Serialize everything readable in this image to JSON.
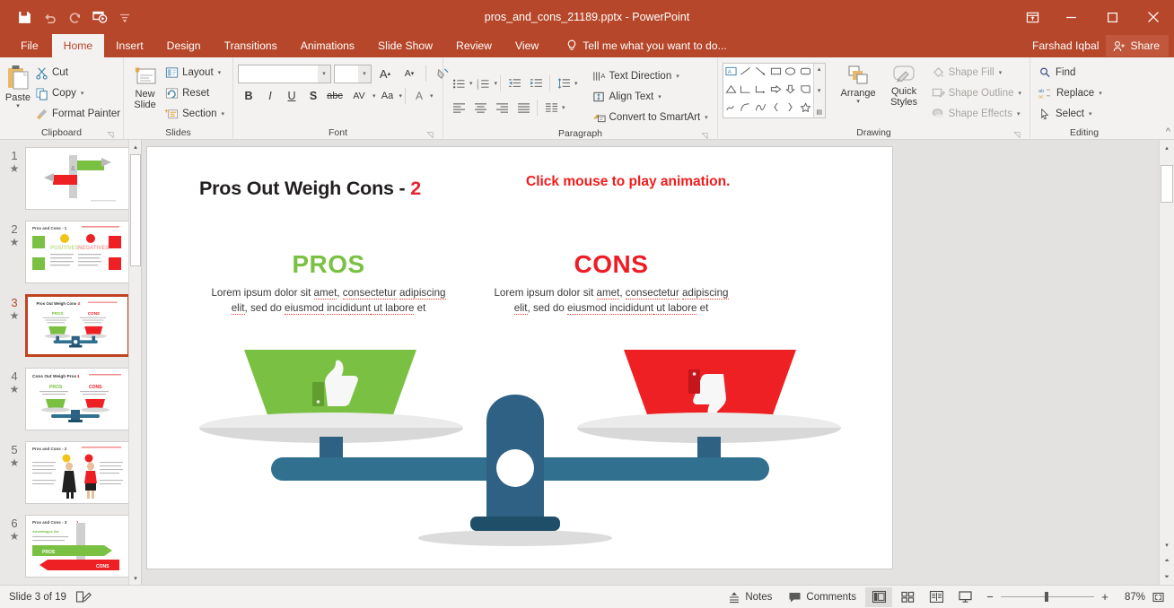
{
  "window": {
    "title": "pros_and_cons_21189.pptx - PowerPoint",
    "accent_color": "#b7472a",
    "quick_access": [
      {
        "name": "save-icon",
        "label": "Save"
      },
      {
        "name": "undo-icon",
        "label": "Undo"
      },
      {
        "name": "redo-icon",
        "label": "Redo"
      },
      {
        "name": "start-presentation-icon",
        "label": "Start From Beginning"
      },
      {
        "name": "customize-qat-icon",
        "label": "Customize Quick Access Toolbar"
      }
    ],
    "controls": {
      "ribbon_display": "Ribbon Display Options",
      "minimize": "—",
      "restore": "□",
      "close": "✕"
    },
    "user_name": "Farshad Iqbal",
    "share_label": "Share"
  },
  "tabs": [
    {
      "label": "File",
      "active": false
    },
    {
      "label": "Home",
      "active": true
    },
    {
      "label": "Insert",
      "active": false
    },
    {
      "label": "Design",
      "active": false
    },
    {
      "label": "Transitions",
      "active": false
    },
    {
      "label": "Animations",
      "active": false
    },
    {
      "label": "Slide Show",
      "active": false
    },
    {
      "label": "Review",
      "active": false
    },
    {
      "label": "View",
      "active": false
    }
  ],
  "tell_me": {
    "label": "Tell me what you want to do...",
    "icon": "lightbulb-icon"
  },
  "ribbon": {
    "clipboard": {
      "title": "Clipboard",
      "paste": "Paste",
      "cut": "Cut",
      "copy": "Copy",
      "format_painter": "Format Painter"
    },
    "slides": {
      "title": "Slides",
      "new_slide": "New\nSlide",
      "new_slide_line1": "New",
      "new_slide_line2": "Slide",
      "layout": "Layout",
      "reset": "Reset",
      "section": "Section"
    },
    "font": {
      "title": "Font",
      "font_name_value": "",
      "font_size_value": "",
      "font_name_placeholder": "",
      "font_size_placeholder": "",
      "grow_font": "A",
      "shrink_font": "A",
      "clear_formatting": "✐",
      "bold": "B",
      "italic": "I",
      "underline": "U",
      "shadow": "S",
      "strikethrough": "abc",
      "char_spacing": "AV",
      "change_case": "Aa",
      "font_color": "A"
    },
    "paragraph": {
      "title": "Paragraph",
      "text_direction": "Text Direction",
      "align_text": "Align Text",
      "convert_smartart": "Convert to SmartArt"
    },
    "drawing": {
      "title": "Drawing",
      "arrange": "Arrange",
      "quick_styles_line1": "Quick",
      "quick_styles_line2": "Styles",
      "shape_fill": "Shape Fill",
      "shape_outline": "Shape Outline",
      "shape_effects": "Shape Effects",
      "shapes": [
        "A",
        "╲",
        "╲",
        "▭",
        "◯",
        "▢",
        "△",
        "⌐",
        "⌙",
        "⇨",
        "⇩",
        "⬚",
        "ʃ",
        "⌒",
        "∿",
        "{",
        "}",
        "☆"
      ]
    },
    "editing": {
      "title": "Editing",
      "find": "Find",
      "replace": "Replace",
      "select": "Select",
      "collapse": "^"
    }
  },
  "thumbnails": [
    {
      "number": "1",
      "animated": true,
      "selected": false
    },
    {
      "number": "2",
      "animated": true,
      "selected": false
    },
    {
      "number": "3",
      "animated": true,
      "selected": true
    },
    {
      "number": "4",
      "animated": true,
      "selected": false
    },
    {
      "number": "5",
      "animated": true,
      "selected": false
    },
    {
      "number": "6",
      "animated": true,
      "selected": false
    }
  ],
  "slide": {
    "title_text": "Pros Out Weigh Cons - ",
    "title_number": "2",
    "animation_note": "Click mouse to play animation.",
    "pros": {
      "heading": "PROS",
      "heading_color": "#7ac143",
      "line1_a": "Lorem ipsum dolor sit ",
      "line1_b": "amet",
      "line1_c": ", ",
      "line1_d": "consectetur",
      "line2_a": "adipiscing elit",
      "line2_b": ", sed do ",
      "line2_c": "eiusmod",
      "line3_a": "incididunt",
      "line3_b": " ut labore",
      "line3_c": " et",
      "pan_color": "#7ac143",
      "icon": "thumbs-up-icon"
    },
    "cons": {
      "heading": "CONS",
      "heading_color": "#ee1c25",
      "line1_a": "Lorem ipsum dolor sit ",
      "line1_b": "amet",
      "line1_c": ", ",
      "line1_d": "consectetur",
      "line2_a": "adipiscing elit",
      "line2_b": ", sed do ",
      "line2_c": "eiusmod",
      "line3_a": "incididunt",
      "line3_b": " ut labore",
      "line3_c": " et",
      "pan_color": "#ee2024",
      "icon": "thumbs-down-icon"
    },
    "scale_colors": {
      "beam": "#2e6183",
      "beam_light": "#31708f",
      "base": "#1f4e68",
      "dish": "#d8d8d8",
      "dish_light": "#ebebeb",
      "shadow": "#dcdcdc"
    }
  },
  "statusbar": {
    "slide_counter": "Slide 3 of 19",
    "notes_label": "Notes",
    "comments_label": "Comments",
    "language_icon": "language-proofing-icon",
    "views": [
      {
        "name": "normal-view",
        "active": true
      },
      {
        "name": "slide-sorter-view",
        "active": false
      },
      {
        "name": "reading-view",
        "active": false
      },
      {
        "name": "slide-show-view",
        "active": false
      }
    ],
    "zoom_out": "−",
    "zoom_in": "+",
    "zoom_percent": "87%",
    "fit_to_window": "fit-slide-icon"
  }
}
